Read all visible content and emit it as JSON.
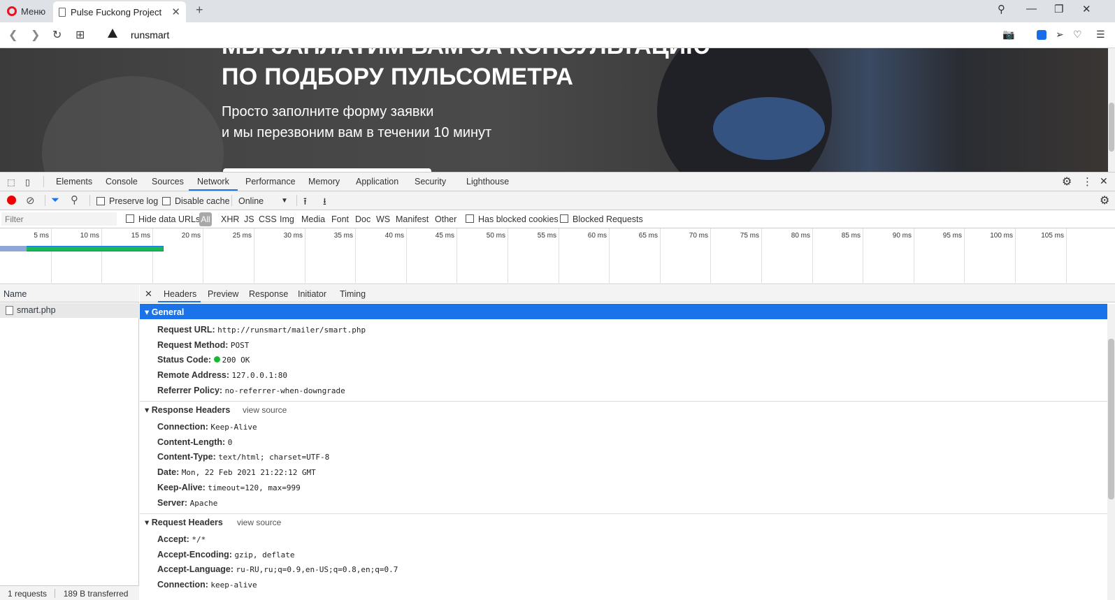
{
  "browser": {
    "menu_label": "Меню",
    "tab_title": "Pulse Fuckong Project",
    "new_tab": "+",
    "url": "runsmart"
  },
  "page": {
    "heading": "ПО ПОДБОРУ ПУЛЬСОМЕТРА",
    "heading_cut": "МЫ ЗАПЛАТИМ ВАМ ЗА КОНСУЛЬТАЦИЮ",
    "line1": "Просто заполните форму заявки",
    "line2": "и мы перезвоним вам в течении 10 минут"
  },
  "devtools": {
    "tabs": [
      "Elements",
      "Console",
      "Sources",
      "Network",
      "Performance",
      "Memory",
      "Application",
      "Security",
      "Lighthouse"
    ],
    "active_tab": "Network",
    "toolbar": {
      "preserve_log": "Preserve log",
      "disable_cache": "Disable cache",
      "throttle": "Online"
    },
    "filter": {
      "placeholder": "Filter",
      "hide_data_urls": "Hide data URLs",
      "all": "All",
      "types": [
        "XHR",
        "JS",
        "CSS",
        "Img",
        "Media",
        "Font",
        "Doc",
        "WS",
        "Manifest",
        "Other"
      ],
      "has_blocked_cookies": "Has blocked cookies",
      "blocked_requests": "Blocked Requests"
    },
    "timeline_ticks": [
      "5 ms",
      "10 ms",
      "15 ms",
      "20 ms",
      "25 ms",
      "30 ms",
      "35 ms",
      "40 ms",
      "45 ms",
      "50 ms",
      "55 ms",
      "60 ms",
      "65 ms",
      "70 ms",
      "75 ms",
      "80 ms",
      "85 ms",
      "90 ms",
      "95 ms",
      "100 ms",
      "105 ms"
    ],
    "names": {
      "header": "Name",
      "row": "smart.php",
      "footer_requests": "1 requests",
      "footer_transferred": "189 B transferred"
    },
    "detail_tabs": [
      "Headers",
      "Preview",
      "Response",
      "Initiator",
      "Timing"
    ],
    "general": {
      "title": "General",
      "rows": [
        {
          "k": "Request URL:",
          "v": "http://runsmart/mailer/smart.php"
        },
        {
          "k": "Request Method:",
          "v": "POST"
        },
        {
          "k": "Status Code:",
          "v": "200 OK"
        },
        {
          "k": "Remote Address:",
          "v": "127.0.0.1:80"
        },
        {
          "k": "Referrer Policy:",
          "v": "no-referrer-when-downgrade"
        }
      ]
    },
    "response_headers": {
      "title": "Response Headers",
      "view_source": "view source",
      "rows": [
        {
          "k": "Connection:",
          "v": "Keep-Alive"
        },
        {
          "k": "Content-Length:",
          "v": "0"
        },
        {
          "k": "Content-Type:",
          "v": "text/html; charset=UTF-8"
        },
        {
          "k": "Date:",
          "v": "Mon, 22 Feb 2021 21:22:12 GMT"
        },
        {
          "k": "Keep-Alive:",
          "v": "timeout=120, max=999"
        },
        {
          "k": "Server:",
          "v": "Apache"
        }
      ]
    },
    "request_headers": {
      "title": "Request Headers",
      "view_source": "view source",
      "rows": [
        {
          "k": "Accept:",
          "v": "*/*"
        },
        {
          "k": "Accept-Encoding:",
          "v": "gzip, deflate"
        },
        {
          "k": "Accept-Language:",
          "v": "ru-RU,ru;q=0.9,en-US;q=0.8,en;q=0.7"
        },
        {
          "k": "Connection:",
          "v": "keep-alive"
        }
      ]
    }
  }
}
